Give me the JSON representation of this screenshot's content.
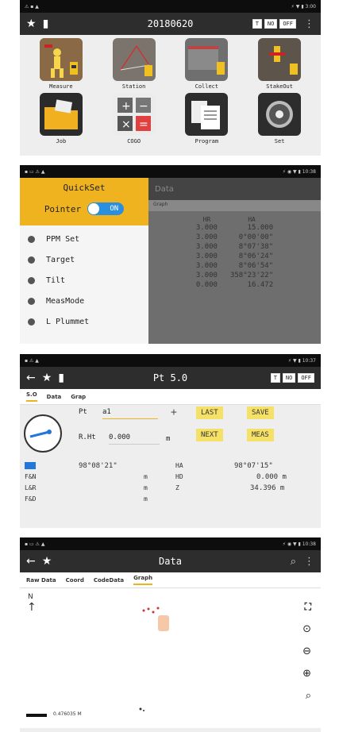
{
  "panel1": {
    "title": "20180620",
    "badges": [
      "T",
      "NO",
      "OFF"
    ],
    "tiles": [
      {
        "label": "Measure"
      },
      {
        "label": "Station"
      },
      {
        "label": "Collect"
      },
      {
        "label": "StakeOut"
      },
      {
        "label": "Job"
      },
      {
        "label": "COGO"
      },
      {
        "label": "Program"
      },
      {
        "label": "Set"
      }
    ]
  },
  "panel2": {
    "title": "QuickSet",
    "pointer_label": "Pointer",
    "toggle": "ON",
    "items": [
      "PPM Set",
      "Target",
      "Tilt",
      "MeasMode",
      "L Plummet"
    ],
    "bg_title": "Data",
    "bg_tab": "Graph",
    "columns": [
      "HR",
      "HA"
    ],
    "rows": [
      [
        "3.000",
        "15.000"
      ],
      [
        "3.000",
        "0°00'00\""
      ],
      [
        "3.000",
        "8°07'38\""
      ],
      [
        "3.000",
        "8°06'24\""
      ],
      [
        "3.000",
        "8°06'54\""
      ],
      [
        "3.000",
        "358°23'22\""
      ],
      [
        "0.000",
        "16.472"
      ]
    ]
  },
  "panel3": {
    "title": "Pt 5.0",
    "badges": [
      "T",
      "NO",
      "OFF"
    ],
    "tabs": [
      "S.O",
      "Data",
      "Grap"
    ],
    "pt_label": "Pt",
    "pt_value": "a1",
    "rht_label": "R.Ht",
    "rht_value": "0.000",
    "unit_m": "m",
    "buttons": [
      "LAST",
      "SAVE",
      "NEXT",
      "MEAS"
    ],
    "angle1": "98°08'21\"",
    "ha_label": "HA",
    "ha_value": "98°07'15\"",
    "rows": [
      {
        "label": "F&N",
        "unit": "m",
        "k": "HD",
        "v": "0.000 m"
      },
      {
        "label": "L&R",
        "unit": "m",
        "k": "Z",
        "v": "34.396 m"
      },
      {
        "label": "F&D",
        "unit": "m",
        "k": "",
        "v": ""
      }
    ]
  },
  "panel4": {
    "title": "Data",
    "tabs": [
      "Raw Data",
      "Coord",
      "CodeData",
      "Graph"
    ],
    "north": "N",
    "scale": "0.476035 M"
  }
}
